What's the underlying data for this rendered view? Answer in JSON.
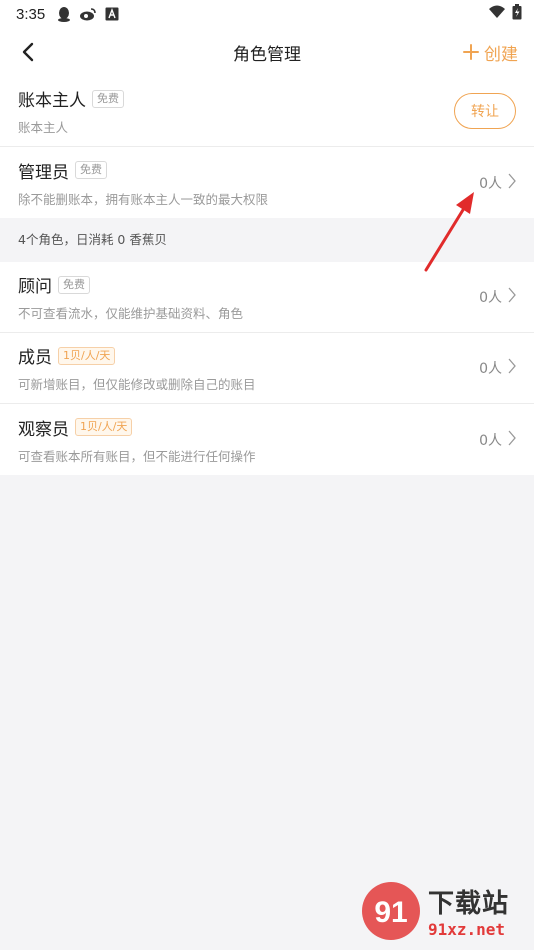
{
  "status_bar": {
    "time": "3:35",
    "icons": [
      "qq-icon",
      "weibo-icon",
      "font-a-icon"
    ],
    "right_icons": [
      "wifi-icon",
      "battery-icon"
    ]
  },
  "nav": {
    "title": "角色管理",
    "create_label": "创建",
    "accent_color": "#f0a452"
  },
  "owner": {
    "name": "账本主人",
    "badge": "免费",
    "desc": "账本主人",
    "button": "转让"
  },
  "admin": {
    "name": "管理员",
    "badge": "免费",
    "desc": "除不能删账本，拥有账本主人一致的最大权限",
    "count": "0人"
  },
  "summary": "4个角色，日消耗 0 香蕉贝",
  "roles": [
    {
      "name": "顾问",
      "badge": "免费",
      "paid": false,
      "desc": "不可查看流水，仅能维护基础资料、角色",
      "count": "0人"
    },
    {
      "name": "成员",
      "badge": "1贝/人/天",
      "paid": true,
      "desc": "可新增账目，但仅能修改或删除自己的账目",
      "count": "0人"
    },
    {
      "name": "观察员",
      "badge": "1贝/人/天",
      "paid": true,
      "desc": "可查看账本所有账目，但不能进行任何操作",
      "count": "0人"
    }
  ],
  "watermark": {
    "logo_text": "91",
    "cn_text": "下载站",
    "url_text": "91xz.net"
  }
}
